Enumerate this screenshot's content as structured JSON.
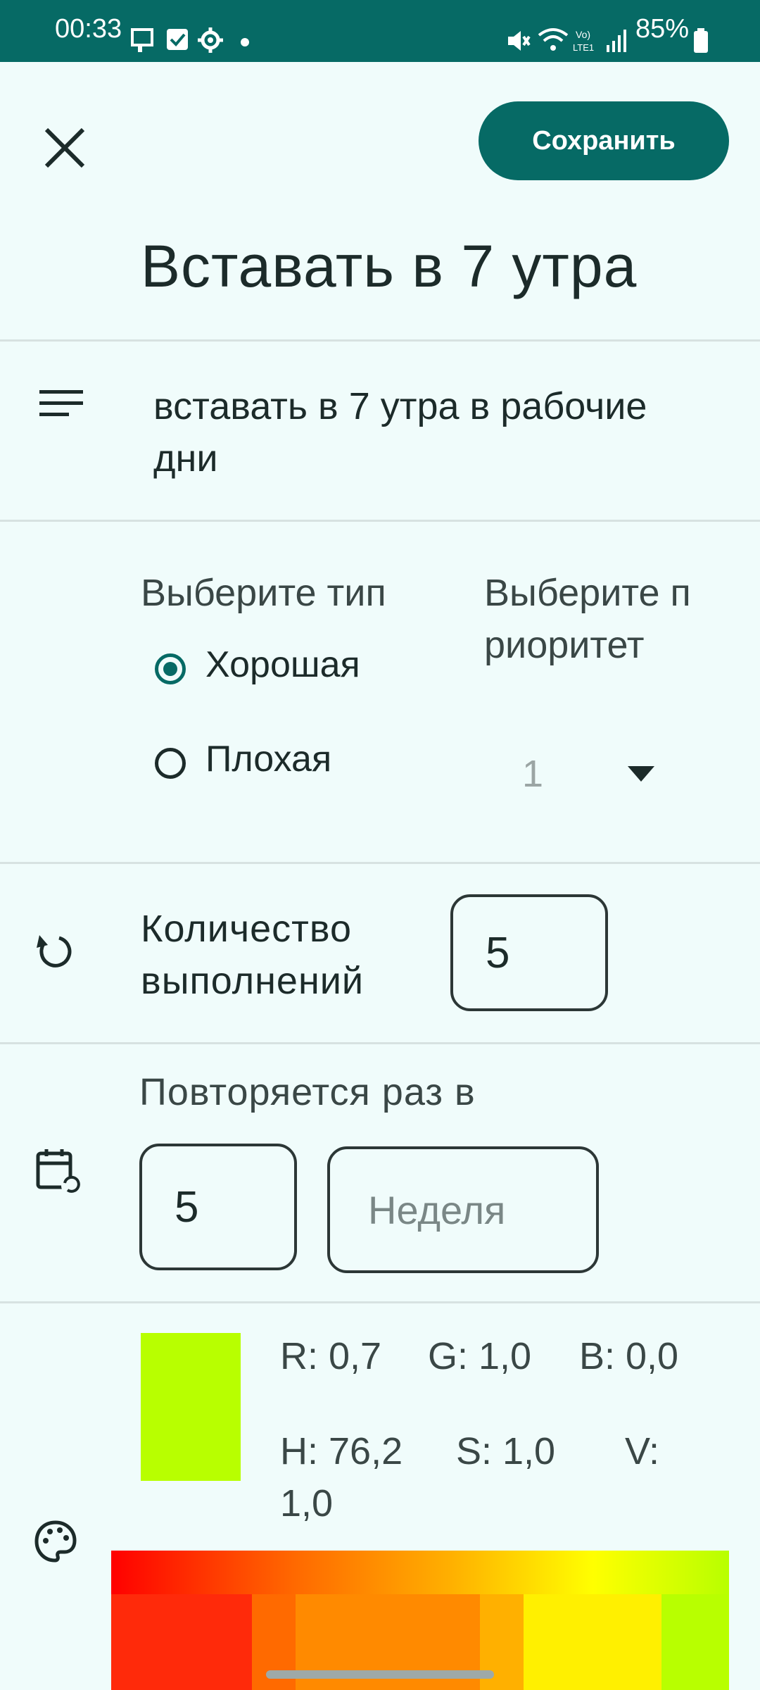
{
  "status_bar": {
    "time": "00:33",
    "battery": "85%",
    "icons": [
      "sim-icon",
      "checkbox-notification-icon",
      "settings-notification-icon",
      "dot-icon",
      "mute-icon",
      "wifi-icon",
      "volte-icon",
      "signal-icon",
      "battery-icon"
    ]
  },
  "toolbar": {
    "close_icon": "close-icon",
    "save_label": "Сохранить"
  },
  "title": "Вставать в 7 утра",
  "description": {
    "icon": "notes-icon",
    "text": "вставать в 7 утра в рабочие дни"
  },
  "type_section": {
    "label": "Выберите тип",
    "options": [
      {
        "label": "Хорошая",
        "checked": true
      },
      {
        "label": "Плохая",
        "checked": false
      }
    ]
  },
  "priority_section": {
    "label": "Выберите приоритет",
    "selected": "1"
  },
  "executions": {
    "icon": "repeat-icon",
    "label": "Количество выполнений",
    "value": "5"
  },
  "repeat": {
    "icon": "calendar-repeat-icon",
    "label": "Повторяется раз в",
    "count": "5",
    "unit": "Неделя"
  },
  "color": {
    "icon": "palette-icon",
    "swatch": "#B8FF00",
    "r": "R: 0,7",
    "g": "G: 1,0",
    "b": "B: 0,0",
    "h": "H: 76,2",
    "s": "S: 1,0",
    "v_label": "V:",
    "v_value": "1,0",
    "gradient_cells": [
      "#FF2A0A",
      "#FF6A00",
      "#FF8A00",
      "#FFB000",
      "#FFE100",
      "#FFF000",
      "#B8FF00"
    ]
  }
}
